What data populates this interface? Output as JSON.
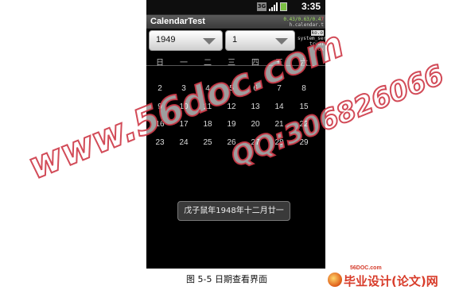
{
  "status_bar": {
    "network_badge": "3G",
    "time": "3:35",
    "colors": {
      "battery": "#7bc043"
    }
  },
  "app": {
    "title": "CalendarTest",
    "overlay_stats": "0.43/0.63/0.4",
    "overlay_stats_red": "7",
    "overlay_line2": "h.calendar.t",
    "side_label_1": "ko.o",
    "side_label_2": "system_server",
    "side_label_3": "trudi",
    "side_label_4": "ox"
  },
  "year_selector": {
    "value": "1949"
  },
  "month_selector": {
    "value": "1"
  },
  "calendar": {
    "weekdays": [
      "日",
      "一",
      "二",
      "三",
      "四",
      "五",
      "六"
    ],
    "days": [
      "2",
      "3",
      "4",
      "5",
      "6",
      "7",
      "8",
      "9",
      "10",
      "11",
      "12",
      "13",
      "14",
      "15",
      "16",
      "17",
      "18",
      "19",
      "20",
      "21",
      "22",
      "23",
      "24",
      "25",
      "26",
      "27",
      "28",
      "29"
    ]
  },
  "lunar_info": "戊子鼠年1948年十二月廿一",
  "caption": "图 5-5  日期查看界面",
  "watermark": {
    "site": "www.56doc.com",
    "qq": "QQ:306826066"
  },
  "brand": {
    "site": "56DOC.com",
    "name": "毕业设计(论文)网"
  }
}
